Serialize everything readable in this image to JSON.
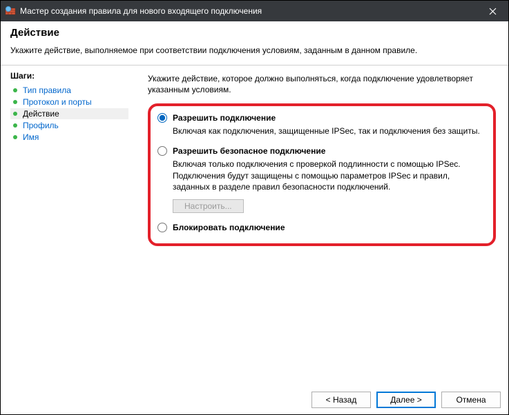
{
  "titlebar": {
    "title": "Мастер создания правила для нового входящего подключения"
  },
  "header": {
    "title": "Действие",
    "subtitle": "Укажите действие, выполняемое при соответствии подключения условиям, заданным в данном правиле."
  },
  "sidebar": {
    "title": "Шаги:",
    "steps": [
      {
        "label": "Тип правила",
        "current": false
      },
      {
        "label": "Протокол и порты",
        "current": false
      },
      {
        "label": "Действие",
        "current": true
      },
      {
        "label": "Профиль",
        "current": false
      },
      {
        "label": "Имя",
        "current": false
      }
    ]
  },
  "content": {
    "instruction": "Укажите действие, которое должно выполняться, когда подключение удовлетворяет указанным условиям.",
    "options": {
      "allow": {
        "label": "Разрешить подключение",
        "desc": "Включая как подключения, защищенные IPSec, так и подключения без защиты."
      },
      "allow_secure": {
        "label": "Разрешить безопасное подключение",
        "desc": "Включая только подключения с проверкой подлинности с помощью IPSec. Подключения будут защищены с помощью параметров IPSec и правил, заданных в разделе правил безопасности подключений.",
        "configure": "Настроить..."
      },
      "block": {
        "label": "Блокировать подключение"
      }
    }
  },
  "footer": {
    "back": "< Назад",
    "next": "Далее >",
    "cancel": "Отмена"
  }
}
